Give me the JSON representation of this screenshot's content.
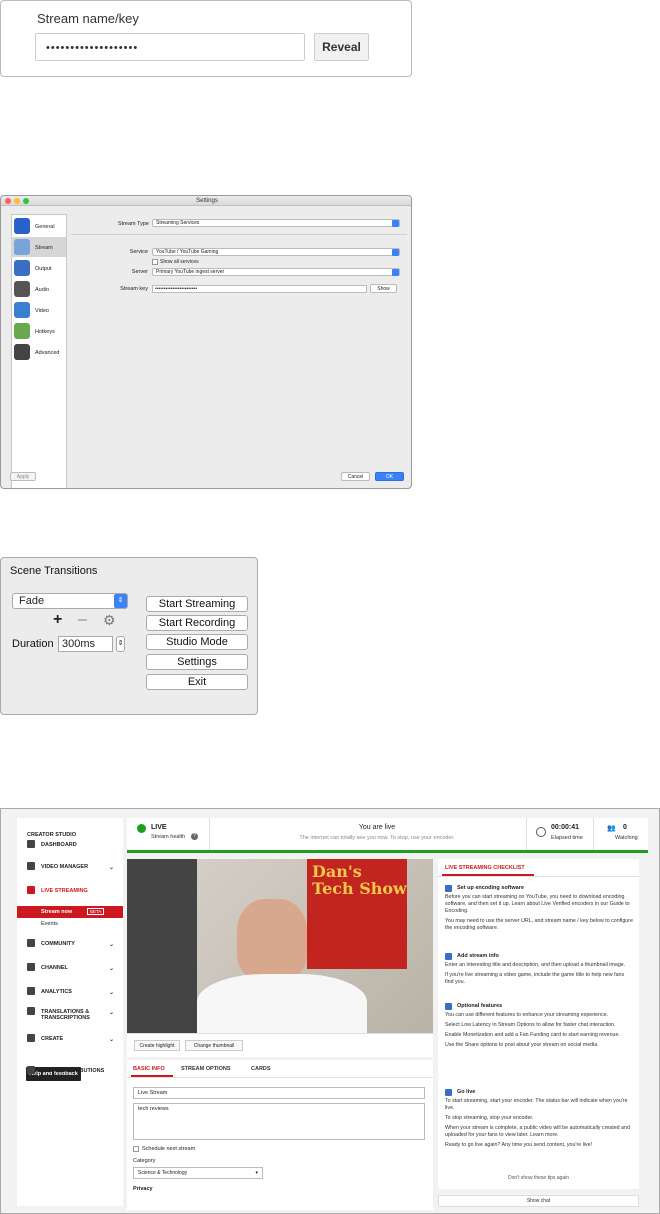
{
  "panel_stream_key": {
    "label": "Stream name/key",
    "value": "•••••••••••••••••••",
    "reveal_button": "Reveal"
  },
  "panel_obs_settings": {
    "window_title": "Settings",
    "sidebar": [
      {
        "label": "General",
        "icon": "general-icon"
      },
      {
        "label": "Stream",
        "icon": "stream-icon"
      },
      {
        "label": "Output",
        "icon": "output-icon"
      },
      {
        "label": "Audio",
        "icon": "audio-icon"
      },
      {
        "label": "Video",
        "icon": "video-icon"
      },
      {
        "label": "Hotkeys",
        "icon": "hotkeys-icon"
      },
      {
        "label": "Advanced",
        "icon": "advanced-icon"
      }
    ],
    "stream_type_label": "Stream Type",
    "stream_type_value": "Streaming Services",
    "service_label": "Service",
    "service_value": "YouTube / YouTube Gaming",
    "show_all_services": "Show all services",
    "server_label": "Server",
    "server_value": "Primary YouTube ingest server",
    "stream_key_label": "Stream key",
    "stream_key_value": "••••••••••••••••••••••••",
    "show_button": "Show",
    "apply_button": "Apply",
    "cancel_button": "Cancel",
    "ok_button": "OK",
    "accent": "#3b82f6"
  },
  "panel_scene_transitions": {
    "title": "Scene Transitions",
    "transition_value": "Fade",
    "duration_label": "Duration",
    "duration_value": "300ms",
    "buttons": [
      "Start Streaming",
      "Start Recording",
      "Studio Mode",
      "Settings",
      "Exit"
    ]
  },
  "panel_youtube": {
    "brand": "CREATOR STUDIO",
    "nav": [
      {
        "label": "DASHBOARD",
        "icon": "dashboard-icon"
      },
      {
        "label": "VIDEO MANAGER",
        "icon": "video-manager-icon"
      },
      {
        "label": "LIVE STREAMING",
        "icon": "live-icon"
      },
      {
        "label": "COMMUNITY",
        "icon": "community-icon"
      },
      {
        "label": "CHANNEL",
        "icon": "channel-icon"
      },
      {
        "label": "ANALYTICS",
        "icon": "analytics-icon"
      },
      {
        "label": "TRANSLATIONS & TRANSCRIPTIONS",
        "icon": "translate-icon"
      },
      {
        "label": "CREATE",
        "icon": "create-icon"
      },
      {
        "label": "YOUR CONTRIBUTIONS",
        "icon": "contributions-icon"
      }
    ],
    "stream_now": "Stream now",
    "beta": "BETA",
    "events": "Events",
    "help": "Help and feedback",
    "live_label": "LIVE",
    "stream_health": "Stream health",
    "status_title": "You are live",
    "status_sub": "The internet can totally see you now. To stop, use your encoder.",
    "elapsed_value": "00:00:41",
    "elapsed_label": "Elapsed time",
    "watching_value": "0",
    "watching_label": "Watching",
    "video_text": "Dan's Tech Show",
    "create_highlight": "Create highlight",
    "change_thumbnail": "Change thumbnail",
    "tabs": [
      "BASIC INFO",
      "STREAM OPTIONS",
      "CARDS"
    ],
    "title_value": "Live Stream",
    "description_value": "tech reviews",
    "schedule_next": "Schedule next stream",
    "category_label": "Category",
    "category_value": "Science & Technology",
    "privacy_label": "Privacy",
    "checklist_title": "LIVE STREAMING CHECKLIST",
    "tips": [
      {
        "heading": "Set up encoding software",
        "lines": [
          "Before you can start streaming on YouTube, you need to download encoding software, and then set it up. Learn about Live Verified encoders in our Guide to Encoding.",
          "You may need to use the server URL, and stream name / key below to configure the encoding software."
        ]
      },
      {
        "heading": "Add stream info",
        "lines": [
          "Enter an interesting title and description, and then upload a thumbnail image.",
          "If you're live streaming a video game, include the game title to help new fans find you."
        ]
      },
      {
        "heading": "Optional features",
        "lines": [
          "You can use different features to enhance your streaming experience.",
          "Select Low Latency in Stream Options to allow for faster chat interaction.",
          "Enable Monetization and add a Fan Funding card to start earning revenue.",
          "Use the Share options to post about your stream on social media."
        ]
      },
      {
        "heading": "Go live",
        "lines": [
          "To start streaming, start your encoder. The status bar will indicate when you're live.",
          "To stop streaming, stop your encoder.",
          "When your stream is complete, a public video will be automatically created and uploaded for your fans to view later. Learn more.",
          "Ready to go live again? Any time you send content, you're live!"
        ]
      }
    ],
    "dont_show": "Don't show these tips again",
    "show_chat": "Show chat",
    "live_color": "#1e9e1e",
    "accent_red": "#cc181e"
  }
}
